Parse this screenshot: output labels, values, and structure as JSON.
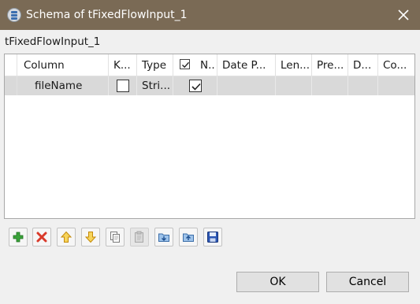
{
  "window": {
    "title": "Schema of tFixedFlowInput_1"
  },
  "component_name": "tFixedFlowInput_1",
  "table": {
    "columns": [
      {
        "label": "Column"
      },
      {
        "label": "K..."
      },
      {
        "label": "Type"
      },
      {
        "label": "N..",
        "checkbox": true
      },
      {
        "label": "Date P..."
      },
      {
        "label": "Len..."
      },
      {
        "label": "Pre..."
      },
      {
        "label": "D..."
      },
      {
        "label": "Co..."
      }
    ],
    "rows": [
      {
        "column": "fileName",
        "key": false,
        "type": "Stri...",
        "nullable": true,
        "date_pattern": "",
        "length": "",
        "precision": "",
        "default": "",
        "comment": ""
      }
    ]
  },
  "toolbar": {
    "buttons": [
      {
        "icon": "add-icon",
        "enabled": true
      },
      {
        "icon": "remove-icon",
        "enabled": true
      },
      {
        "icon": "move-up-icon",
        "enabled": true
      },
      {
        "icon": "move-down-icon",
        "enabled": true
      },
      {
        "icon": "copy-icon",
        "enabled": true
      },
      {
        "icon": "paste-icon",
        "enabled": false
      },
      {
        "icon": "import-icon",
        "enabled": true
      },
      {
        "icon": "export-icon",
        "enabled": true
      },
      {
        "icon": "save-icon",
        "enabled": true
      }
    ]
  },
  "actions": {
    "ok_label": "OK",
    "cancel_label": "Cancel"
  },
  "colors": {
    "titlebar": "#7a6a55",
    "selected_row": "#d9d9d9",
    "add_green": "#3aa33a",
    "remove_red": "#d93a2a",
    "arrow_yellow": "#f2c12e",
    "save_blue": "#2b56b3"
  }
}
